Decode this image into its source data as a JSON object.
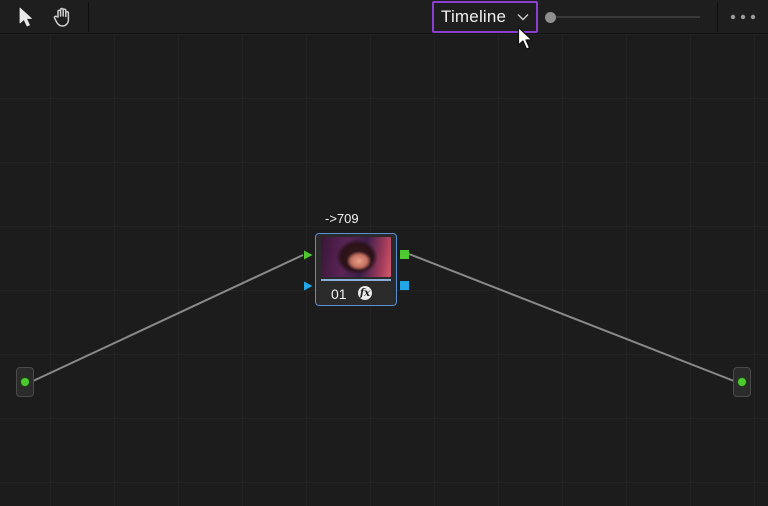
{
  "toolbar": {
    "tools": [
      {
        "name": "pointer",
        "icon": "arrow-pointer-icon"
      },
      {
        "name": "hand",
        "icon": "hand-pan-icon"
      }
    ],
    "mode_dropdown": {
      "selected": "Timeline",
      "icon": "chevron-down-icon",
      "highlight_color": "#8a3fd1"
    },
    "zoom_slider": {
      "value": 0,
      "icon": "slider-thumb"
    },
    "more_icon": "more-options-icon"
  },
  "node_graph": {
    "node": {
      "label": "->709",
      "number": "01",
      "fx_badge": "fx",
      "border_color": "#5b8fd6"
    },
    "ports": {
      "rgb_color": "#4fc930",
      "alpha_color": "#21a7e8"
    },
    "source_endpoint": {
      "icon": "source-input-icon"
    },
    "output_endpoint": {
      "icon": "output-icon"
    }
  }
}
